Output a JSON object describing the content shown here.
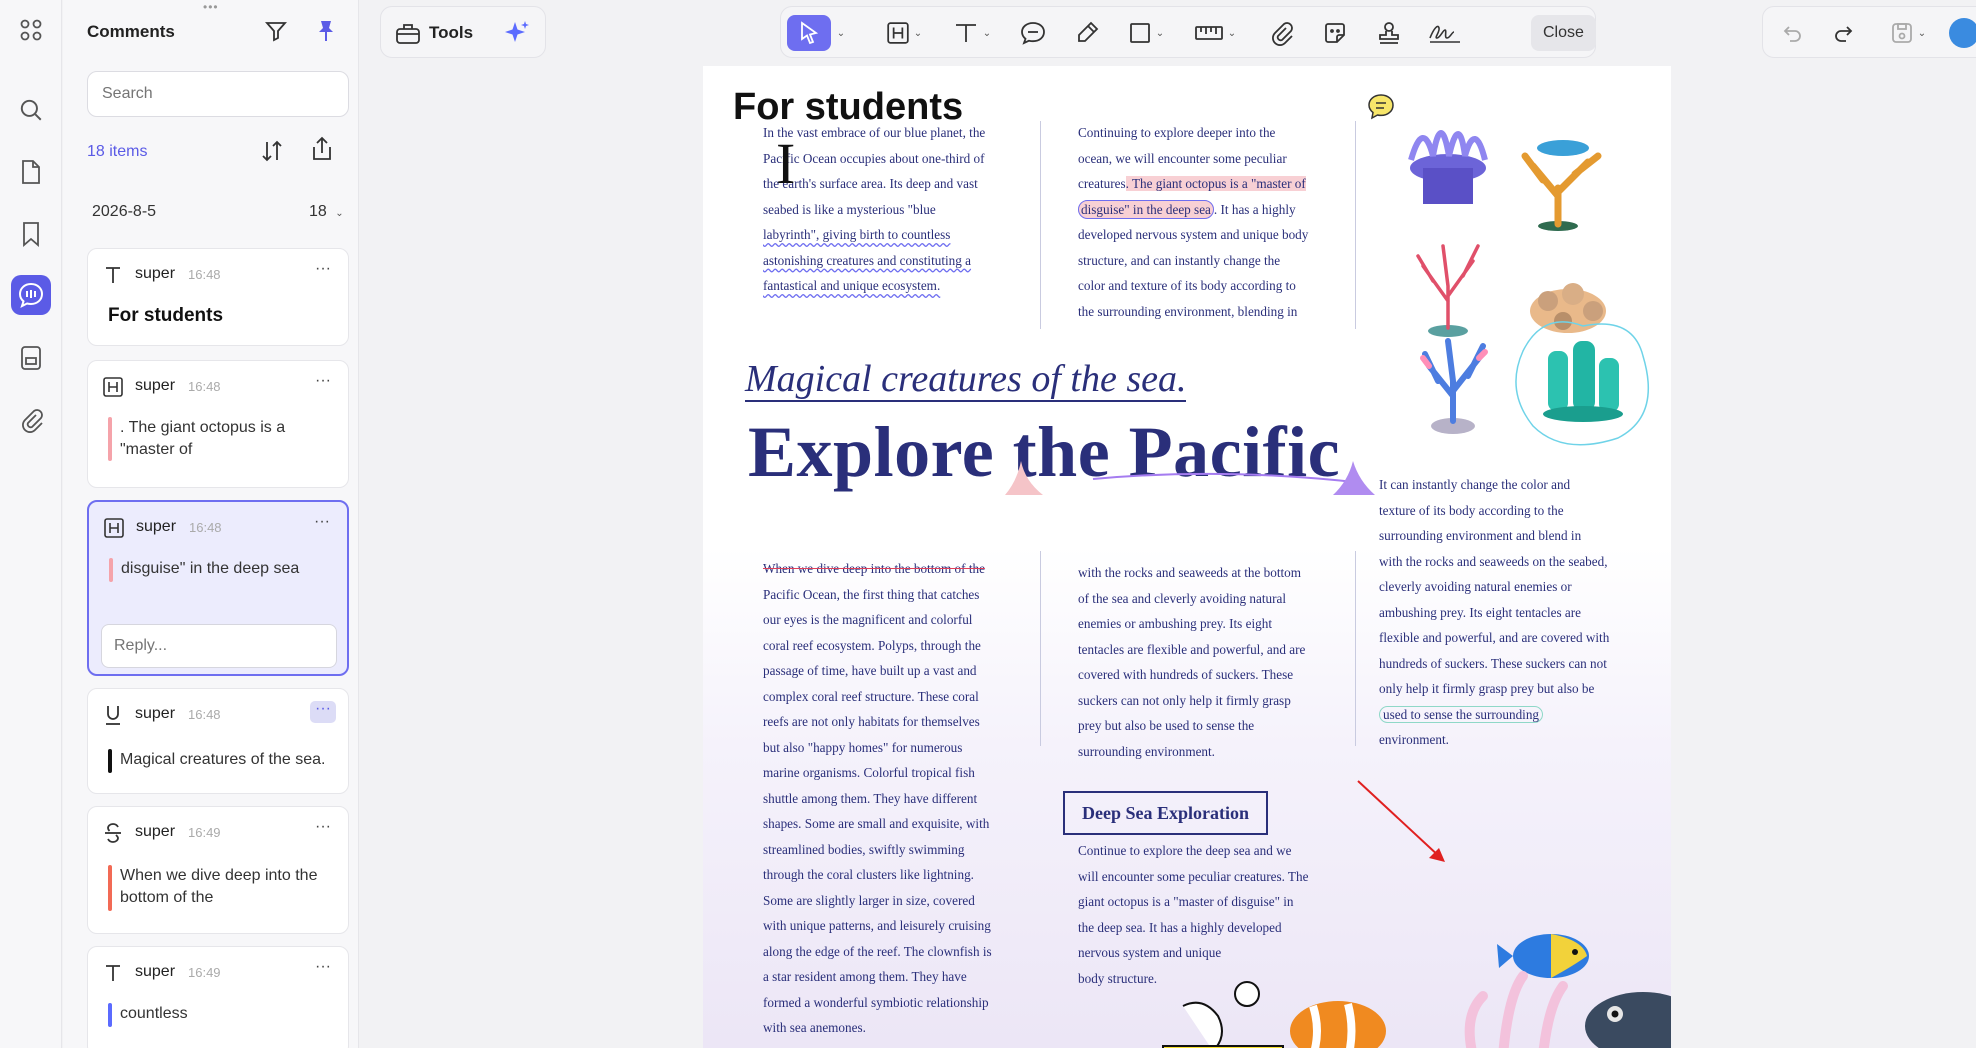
{
  "sidebar_rail": {
    "items": [
      {
        "icon": "apps-grid-icon"
      },
      {
        "icon": "search-icon"
      },
      {
        "icon": "page-icon"
      },
      {
        "icon": "bookmark-icon"
      },
      {
        "icon": "comment-icon",
        "active": true
      },
      {
        "icon": "form-icon"
      },
      {
        "icon": "attachment-icon"
      }
    ]
  },
  "comments_panel": {
    "title": "Comments",
    "search_placeholder": "Search",
    "items_count": "18 items",
    "date_group": "2026-8-5",
    "date_group_count": "18",
    "comments": [
      {
        "type_icon": "text-icon",
        "author": "super",
        "time": "16:48",
        "text": "For students"
      },
      {
        "type_icon": "highlight-icon",
        "author": "super",
        "time": "16:48",
        "text": ". The giant octopus is a \"master of",
        "bar_color": "#f5a3aa"
      },
      {
        "type_icon": "highlight-icon",
        "author": "super",
        "time": "16:48",
        "text": "disguise\" in the deep sea",
        "bar_color": "#f5a3aa",
        "reply_placeholder": "Reply..."
      },
      {
        "type_icon": "underline-icon",
        "author": "super",
        "time": "16:48",
        "text": "Magical creatures of the sea.",
        "bar_color": "#111111"
      },
      {
        "type_icon": "strikethrough-icon",
        "author": "super",
        "time": "16:49",
        "text": "When we dive deep into the bottom of the",
        "bar_color": "#f26a55"
      },
      {
        "type_icon": "text-icon",
        "author": "super",
        "time": "16:49",
        "text": "countless",
        "bar_color": "#5b6bff"
      }
    ]
  },
  "toolbar": {
    "tools_label": "Tools",
    "close_label": "Close",
    "accent": "#6e6ef0"
  },
  "document": {
    "heading_students": "For students",
    "col1_top": [
      "In the vast embrace of our blue planet, the",
      "Pacific Ocean occupies about one-third of",
      "the earth's surface area. Its deep and vast",
      "seabed is like a mysterious \"blue",
      "labyrinth\", giving birth to countless",
      "astonishing creatures and constituting a",
      "fantastical and unique ecosystem."
    ],
    "col2_top": [
      "Continuing to explore deeper into the",
      "ocean, we will encounter some peculiar",
      "creatures",
      ". The giant octopus is a \"master of",
      "disguise\" in the deep sea",
      ". It has a highly",
      "developed nervous system and unique body",
      "structure, and can instantly change the",
      "color and texture of its body according to",
      "the surrounding environment, blending in"
    ],
    "subtitle": "Magical creatures of the sea.",
    "title": "Explore the Pacific",
    "col3_mid": [
      "It can instantly change the color and",
      "texture of its body according to the",
      "surrounding environment and blend in",
      "with the rocks and seaweeds on the seabed,",
      "cleverly avoiding natural enemies or",
      "ambushing prey. Its eight tentacles are",
      "flexible and powerful, and are covered with",
      "hundreds of suckers. These suckers can not",
      "only help it firmly grasp prey but also be",
      "used to sense the surrounding",
      "environment."
    ],
    "col1_bottom_strike": "When we dive deep into the bottom of the",
    "col1_bottom": [
      "Pacific Ocean, the first thing that catches",
      "our eyes is the magnificent and colorful",
      "coral reef ecosystem. Polyps, through the",
      "passage of time, have built up a vast and",
      "complex coral reef structure. These coral",
      "reefs are not only habitats for themselves",
      "but also \"happy homes\" for numerous",
      "marine organisms. Colorful tropical fish",
      "shuttle among them. They have different",
      "shapes. Some are small and exquisite, with",
      "streamlined bodies, swiftly swimming",
      "through the coral clusters like lightning.",
      "Some are slightly larger in size, covered",
      "with unique patterns, and leisurely cruising",
      "along the edge of the reef. The clownfish is",
      "a star resident among them. They have",
      "formed a wonderful symbiotic relationship",
      "with sea anemones."
    ],
    "col2_bottom": [
      "with the rocks and seaweeds at the bottom",
      "of the sea and cleverly avoiding natural",
      "enemies or ambushing prey. Its eight",
      "tentacles are flexible and powerful, and are",
      "covered with hundreds of suckers. These",
      "suckers can not only help it firmly grasp",
      "prey but also be used to sense the",
      "surrounding environment."
    ],
    "deep_sea_heading": "Deep Sea Exploration",
    "deep_sea_text": [
      "Continue to explore the deep sea and we",
      "will encounter some peculiar creatures. The",
      "giant octopus is a \"master of disguise\" in",
      "the deep sea. It has a highly developed",
      "nervous system and unique",
      "body structure."
    ]
  }
}
